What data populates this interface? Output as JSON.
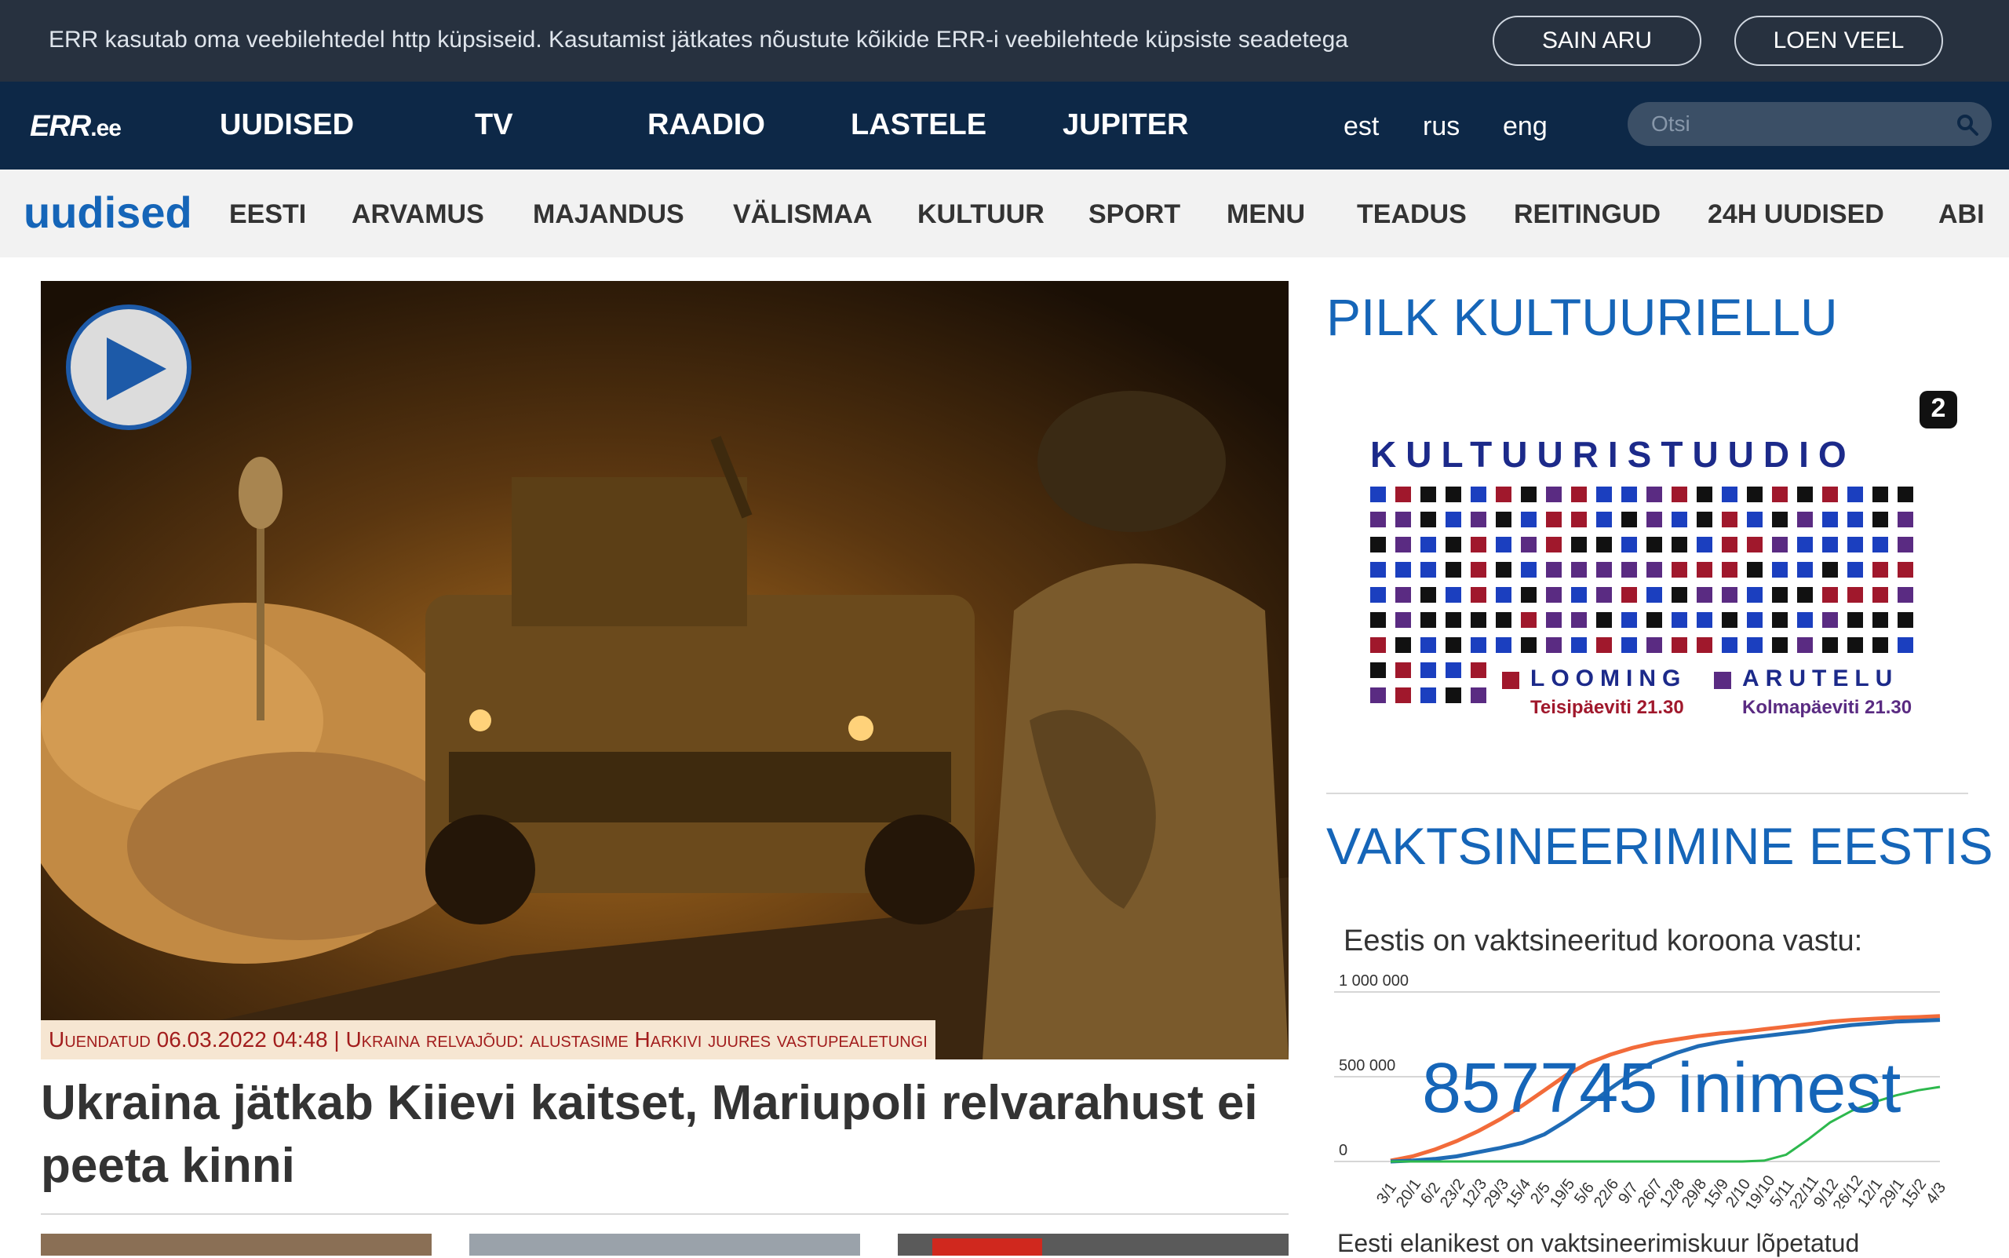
{
  "cookie": {
    "text": "ERR kasutab oma veebilehtedel http küpsiseid. Kasutamist jätkates nõustute kõikide ERR-i veebilehtede küpsiste seadetega",
    "accept_label": "SAIN ARU",
    "more_label": "LOEN VEEL"
  },
  "topnav": {
    "logo": "ERR",
    "logo_suffix": ".ee",
    "items": [
      "UUDISED",
      "TV",
      "RAADIO",
      "LASTELE",
      "JUPITER"
    ],
    "languages": [
      "est",
      "rus",
      "eng"
    ],
    "search_placeholder": "Otsi"
  },
  "section": {
    "title": "uudised",
    "items": [
      "EESTI",
      "ARVAMUS",
      "MAJANDUS",
      "VÄLISMAA",
      "KULTUUR",
      "SPORT",
      "MENU",
      "TEADUS",
      "REITINGUD",
      "24H UUDISED",
      "ABI"
    ]
  },
  "hero": {
    "caption": "Uuendatud 06.03.2022 04:48 | Ukraina relvajõud: alustasime Harkivi juures vastupealetungi",
    "headline": "Ukraina jätkab Kiievi kaitset, Mariupoli relvarahust ei peeta kinni"
  },
  "sidebar": {
    "culture_title": "PILK KULTUURIELLU",
    "kultuuristuudio": {
      "title": "KULTUURISTUUDIO",
      "channel": "2",
      "label1": "LOOMING",
      "time1": "Teisipäeviti 21.30",
      "label2": "ARUTELU",
      "time2": "Kolmapäeviti 21.30"
    },
    "vax_title": "VAKTSINEERIMINE EESTIS",
    "vax_subtitle": "Eestis on vaktsineeritud koroona vastu:",
    "vax_count": "857745 inimest",
    "vax_note": "Eesti elanikest on vaktsineerimiskuur lõpetatud",
    "colors": {
      "accent": "#1565b8",
      "series_orange": "#f26b3a",
      "series_blue": "#1f6bb5",
      "series_green": "#2db84d"
    }
  },
  "chart_data": {
    "type": "line",
    "title": "Eestis on vaktsineeritud koroona vastu:",
    "xlabel": "",
    "ylabel": "",
    "ylim": [
      0,
      1000000
    ],
    "y_ticks": [
      "1 000 000",
      "500 000",
      "0"
    ],
    "x": [
      "3/1",
      "20/1",
      "6/2",
      "23/2",
      "12/3",
      "29/3",
      "15/4",
      "2/5",
      "19/5",
      "5/6",
      "22/6",
      "9/7",
      "26/7",
      "12/8",
      "29/8",
      "15/9",
      "2/10",
      "19/10",
      "5/11",
      "22/11",
      "9/12",
      "26/12",
      "12/1",
      "29/1",
      "15/2",
      "4/3"
    ],
    "series": [
      {
        "color": "#f26b3a",
        "values": [
          5000,
          30000,
          70000,
          120000,
          180000,
          250000,
          330000,
          420000,
          510000,
          580000,
          630000,
          670000,
          700000,
          720000,
          740000,
          755000,
          765000,
          780000,
          795000,
          810000,
          825000,
          835000,
          842000,
          848000,
          852000,
          857745
        ]
      },
      {
        "color": "#1f6bb5",
        "values": [
          0,
          5000,
          15000,
          30000,
          55000,
          80000,
          110000,
          160000,
          240000,
          330000,
          430000,
          520000,
          590000,
          640000,
          680000,
          705000,
          725000,
          740000,
          755000,
          770000,
          790000,
          805000,
          815000,
          825000,
          830000,
          835000
        ]
      },
      {
        "color": "#2db84d",
        "values": [
          0,
          0,
          0,
          0,
          0,
          0,
          0,
          0,
          0,
          0,
          0,
          0,
          0,
          0,
          0,
          0,
          0,
          5000,
          40000,
          130000,
          230000,
          300000,
          350000,
          390000,
          420000,
          440000
        ]
      }
    ]
  }
}
